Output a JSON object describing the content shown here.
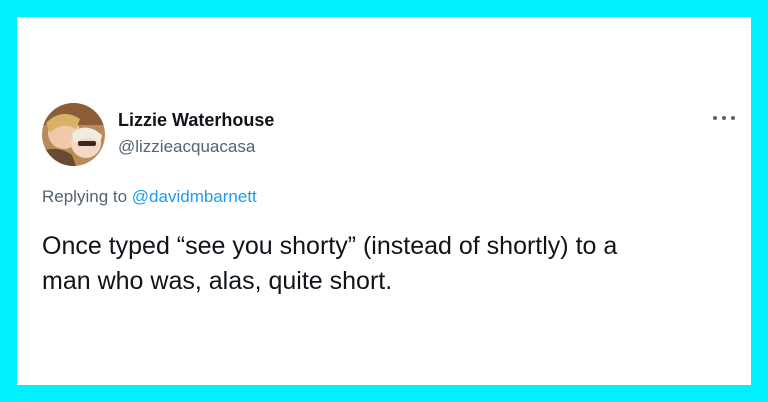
{
  "tweet": {
    "author_name": "Lizzie Waterhouse",
    "author_handle": "@lizzieacquacasa",
    "reply_prefix": "Replying to",
    "reply_to_handle": "@davidmbarnett",
    "text_line_1": "Once typed “see you shorty” (instead of shortly) to a",
    "text_line_2": "man who was, alas, quite short."
  },
  "icons": {
    "more": "more-horizontal-icon",
    "avatar": "profile-photo"
  },
  "colors": {
    "frame": "#00f0ff",
    "card": "#ffffff",
    "text": "#0f1419",
    "secondary": "#536471",
    "link": "#1d9bf0"
  }
}
